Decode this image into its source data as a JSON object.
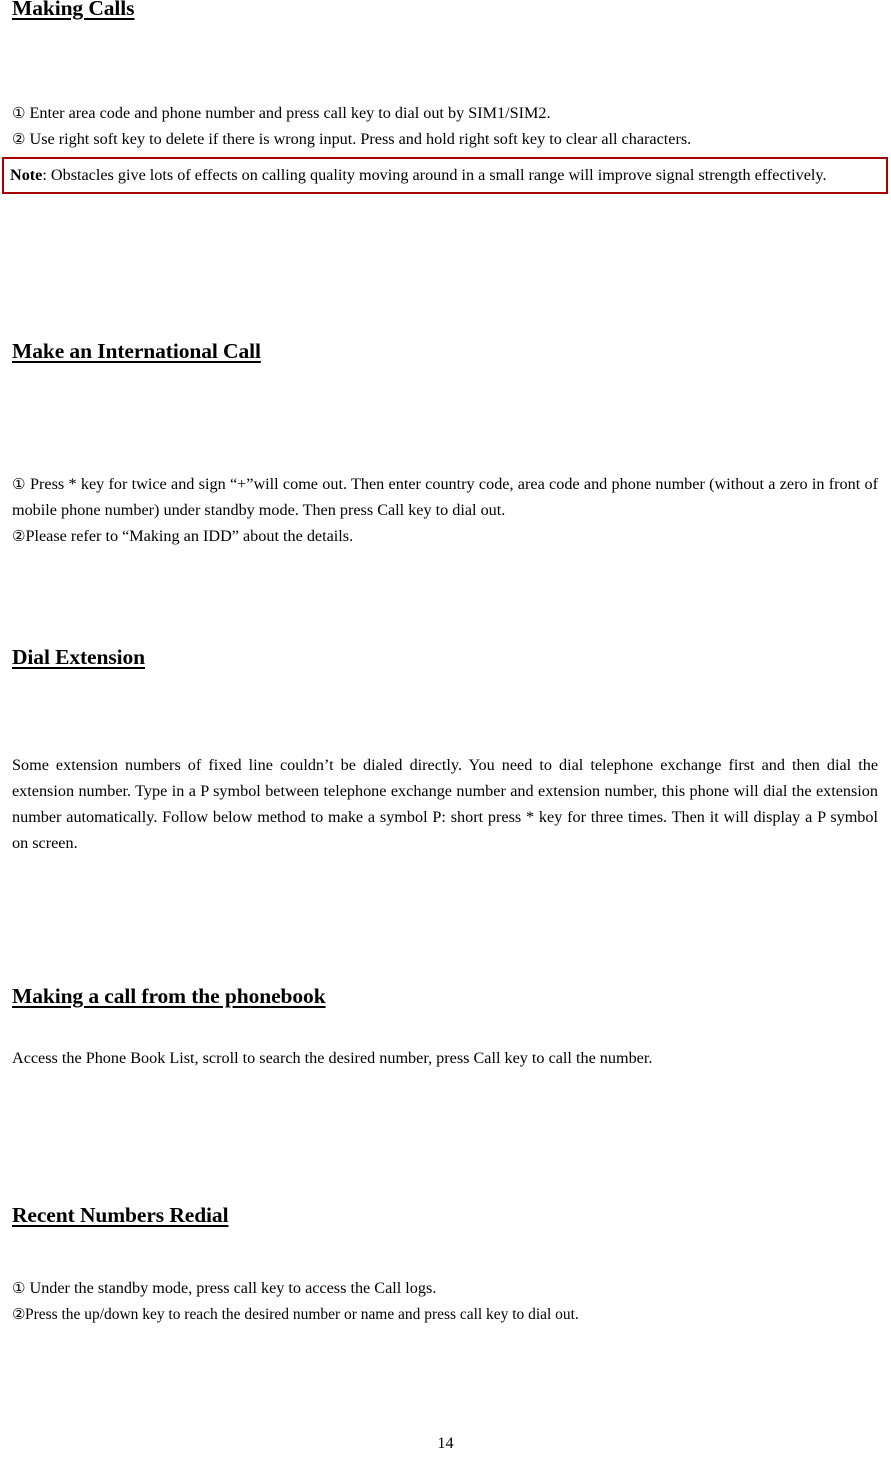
{
  "document": {
    "page_number": "14",
    "note_border_color": "#a80000",
    "text_color": "#000000",
    "background_color": "#ffffff"
  },
  "sections": [
    {
      "heading": "Making Calls",
      "items": [
        {
          "marker": "①",
          "text": "Enter area code and phone number and press call key to dial out by SIM1/SIM2."
        },
        {
          "marker": "②",
          "text": "Use right soft key to delete if there is wrong input. Press and hold right soft key to clear all characters."
        }
      ],
      "note": {
        "label": "Note",
        "text": ": Obstacles give lots of effects on calling quality moving around in a small range will improve signal strength effectively."
      }
    },
    {
      "heading": "Make an International Call",
      "items": [
        {
          "marker": "①",
          "text": "Press * key for twice and sign “+”will come out. Then enter country code, area code and phone number (without a zero in front of mobile phone number) under standby mode. Then press Call key to dial out."
        },
        {
          "marker": "②",
          "text": "Please refer to “Making an IDD” about the details."
        }
      ]
    },
    {
      "heading": "Dial Extension",
      "paragraph": "Some extension numbers of fixed line couldn’t be dialed directly. You need to dial telephone exchange first and then dial the extension number. Type in a P symbol between telephone exchange number and extension number, this phone will dial the extension number automatically. Follow below method to make a symbol P: short press * key for three times. Then it will display a P symbol on screen."
    },
    {
      "heading": "Making a call from the phonebook",
      "paragraph": "Access the Phone Book List, scroll to search the desired number, press Call key to call the number."
    },
    {
      "heading": "Recent Numbers Redial",
      "items": [
        {
          "marker": "①",
          "text": "Under the standby mode, press call key to access the Call logs."
        },
        {
          "marker": "②",
          "text": "Press the up/down key to reach the desired number or name and press call key to dial out."
        }
      ]
    }
  ]
}
